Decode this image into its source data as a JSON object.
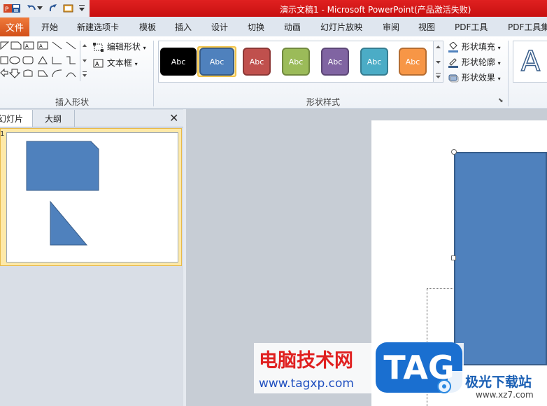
{
  "window": {
    "title": "演示文稿1 - Microsoft PowerPoint(产品激活失败)"
  },
  "tabs": [
    "文件",
    "开始",
    "新建选项卡",
    "模板",
    "插入",
    "设计",
    "切换",
    "动画",
    "幻灯片放映",
    "审阅",
    "视图",
    "PDF工具",
    "PDF工具集"
  ],
  "ribbon": {
    "insert_shapes": {
      "label": "插入形状",
      "edit_shape": "编辑形状",
      "text_box": "文本框"
    },
    "shape_styles": {
      "label": "形状样式",
      "styles": [
        {
          "text": "Abc",
          "color": "#000000"
        },
        {
          "text": "Abc",
          "color": "#4f81bd"
        },
        {
          "text": "Abc",
          "color": "#c0504d"
        },
        {
          "text": "Abc",
          "color": "#9bbb59"
        },
        {
          "text": "Abc",
          "color": "#8064a2"
        },
        {
          "text": "Abc",
          "color": "#4bacc6"
        },
        {
          "text": "Abc",
          "color": "#f79646"
        }
      ],
      "fill": "形状填充",
      "outline": "形状轮廓",
      "effects": "形状效果"
    },
    "wordart_letter": "A"
  },
  "panel": {
    "tab_slides": "幻灯片",
    "tab_outline": "大纲",
    "slide_number": "1"
  },
  "watermark": {
    "site_name": "电脑技术网",
    "site_url": "www.tagxp.com",
    "tag": "TAG",
    "brand": "极光下载站",
    "brand_url": "www.xz7.com"
  }
}
